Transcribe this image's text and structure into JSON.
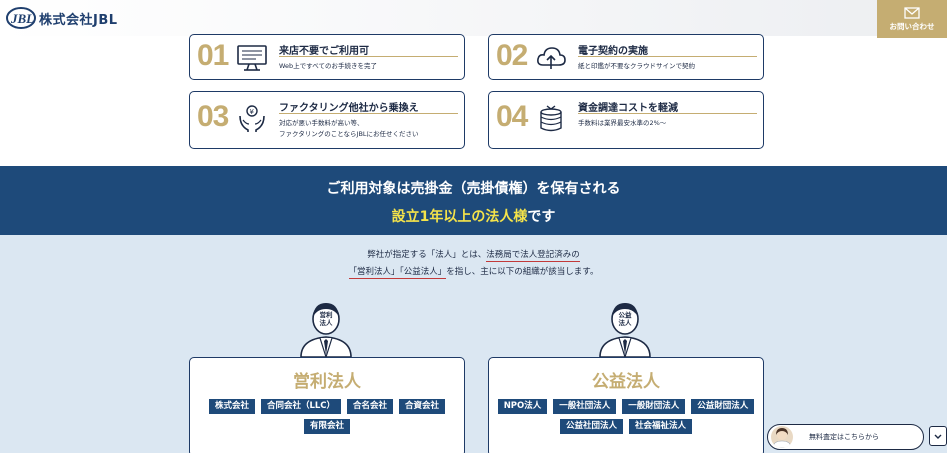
{
  "header": {
    "logo_text": "株式会社JBL",
    "contact_label": "お問い合わせ"
  },
  "features": [
    {
      "num": "01",
      "icon": "monitor-icon",
      "title": "来店不要でご利用可",
      "desc1": "Web上ですべてのお手続きを完了",
      "desc2": ""
    },
    {
      "num": "02",
      "icon": "cloud-upload-icon",
      "title": "電子契約の実施",
      "desc1": "紙と印鑑が不要なクラウドサインで契約",
      "desc2": ""
    },
    {
      "num": "03",
      "icon": "hands-coin-icon",
      "title": "ファクタリング他社から乗換え",
      "desc1": "対応が悪い手数料が高い等、",
      "desc2": "ファクタリングのことならJBLにお任せください"
    },
    {
      "num": "04",
      "icon": "coin-stack-icon",
      "title": "資金調達コストを軽減",
      "desc1": "手数料は業界最安水準の2%〜",
      "desc2": ""
    }
  ],
  "banner": {
    "line1": "ご利用対象は売掛金（売掛債権）を保有される",
    "line2_highlight": "設立1年以上の法人様",
    "line2_rest": "です"
  },
  "intro": {
    "a": "弊社が指定する「法人」とは、",
    "b": "法務局で法人登記済みの",
    "c": "「営利法人」「公益法人」",
    "d": "を指し、主に以下の組織が該当します。"
  },
  "categories": [
    {
      "badge": "営利\n法人",
      "title": "営利法人",
      "tags": [
        "株式会社",
        "合同会社（LLC）",
        "合名会社",
        "合資会社",
        "有限会社"
      ]
    },
    {
      "badge": "公益\n法人",
      "title": "公益法人",
      "tags": [
        "NPO法人",
        "一般社団法人",
        "一般財団法人",
        "公益財団法人",
        "公益社団法人",
        "社会福祉法人"
      ]
    }
  ],
  "chat": {
    "label": "無料査定はこちらから"
  },
  "colors": {
    "navy": "#1e4a7a",
    "gold": "#c5ad72",
    "highlight": "#f4e34a",
    "light_blue_bg": "#dbe7f2",
    "underline_red": "#c23a3a"
  }
}
